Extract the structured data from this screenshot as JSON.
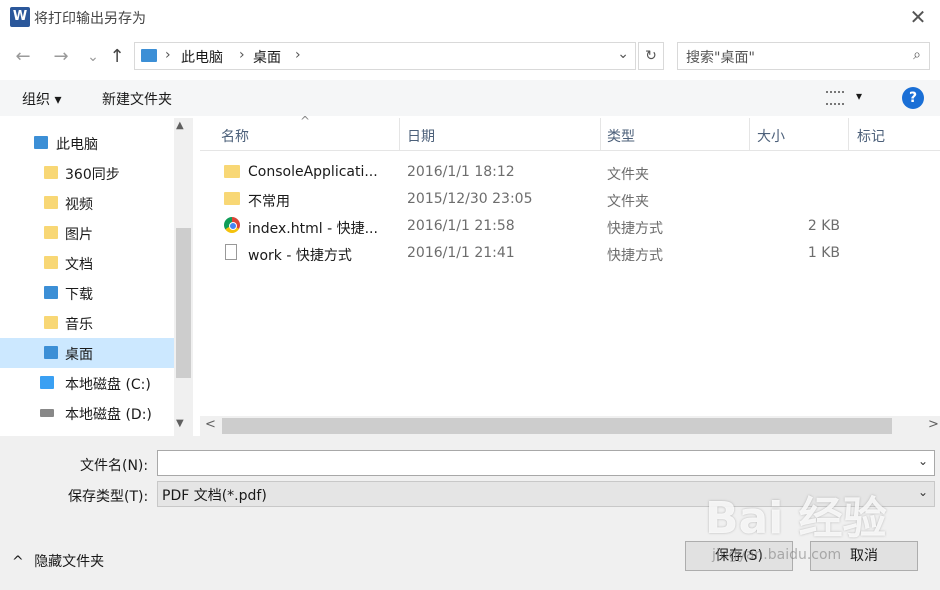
{
  "window": {
    "title": "将打印输出另存为",
    "app_icon": "W",
    "close": "✕"
  },
  "nav": {
    "back": "←",
    "forward": "→",
    "history": "⌄",
    "up": "↑"
  },
  "address": {
    "segments": [
      "此电脑",
      "桌面"
    ],
    "sep": "›",
    "dropdown": "⌄",
    "refresh": "↻"
  },
  "search": {
    "placeholder": "搜索\"桌面\""
  },
  "toolbar": {
    "organize": "组织 ▾",
    "new_folder": "新建文件夹",
    "view_menu": "▾",
    "help": "?"
  },
  "tree": {
    "items": [
      {
        "label": "此电脑",
        "icon": "computer-icon",
        "color": "#3c8fd6"
      },
      {
        "label": "360同步",
        "icon": "sync-folder-icon",
        "color": "#f8d775"
      },
      {
        "label": "视频",
        "icon": "video-folder-icon",
        "color": "#f8d775"
      },
      {
        "label": "图片",
        "icon": "pictures-folder-icon",
        "color": "#f8d775"
      },
      {
        "label": "文档",
        "icon": "documents-folder-icon",
        "color": "#f8d775"
      },
      {
        "label": "下载",
        "icon": "downloads-folder-icon",
        "color": "#3c8fd6"
      },
      {
        "label": "音乐",
        "icon": "music-folder-icon",
        "color": "#f8d775"
      },
      {
        "label": "桌面",
        "icon": "desktop-folder-icon",
        "color": "#3c8fd6",
        "selected": true
      },
      {
        "label": "本地磁盘 (C:)",
        "icon": "windows-drive-icon",
        "color": "#3aa0f3"
      },
      {
        "label": "本地磁盘 (D:)",
        "icon": "drive-icon",
        "color": "#888888"
      }
    ],
    "scroll_up": "▲",
    "scroll_down": "▼"
  },
  "file_list": {
    "columns": [
      "名称",
      "日期",
      "类型",
      "大小",
      "标记"
    ],
    "sort_indicator": "^",
    "rows": [
      {
        "name": "ConsoleApplicati...",
        "date": "2016/1/1 18:12",
        "type": "文件夹",
        "size": "",
        "icon": "folder-icon"
      },
      {
        "name": "不常用",
        "date": "2015/12/30 23:05",
        "type": "文件夹",
        "size": "",
        "icon": "folder-icon"
      },
      {
        "name": "index.html - 快捷...",
        "date": "2016/1/1 21:58",
        "type": "快捷方式",
        "size": "2 KB",
        "icon": "chrome-shortcut-icon"
      },
      {
        "name": "work - 快捷方式",
        "date": "2016/1/1 21:41",
        "type": "快捷方式",
        "size": "1 KB",
        "icon": "shortcut-icon"
      }
    ],
    "hscroll_left": "<",
    "hscroll_right": ">"
  },
  "form": {
    "filename_label": "文件名(N):",
    "filename_value": "",
    "filetype_label": "保存类型(T):",
    "filetype_value": "PDF 文档(*.pdf)",
    "dropdown_glyph": "⌄"
  },
  "footer": {
    "hide_folders": "隐藏文件夹",
    "hide_glyph": "^",
    "save": "保存(S)",
    "cancel": "取消"
  },
  "watermark": {
    "text": "Bai 经验",
    "url": "jingyan.baidu.com"
  }
}
